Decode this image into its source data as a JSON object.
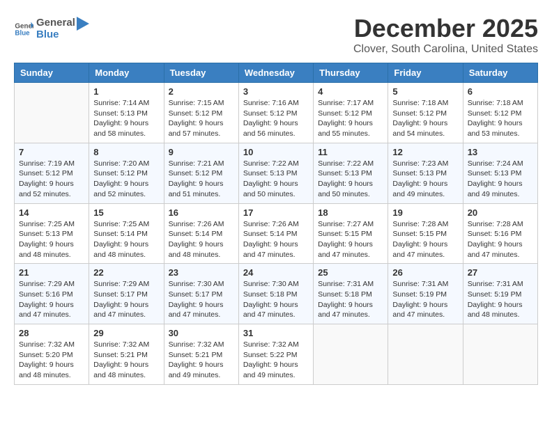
{
  "header": {
    "logo_line1": "General",
    "logo_line2": "Blue",
    "month": "December 2025",
    "location": "Clover, South Carolina, United States"
  },
  "weekdays": [
    "Sunday",
    "Monday",
    "Tuesday",
    "Wednesday",
    "Thursday",
    "Friday",
    "Saturday"
  ],
  "weeks": [
    [
      {
        "day": "",
        "info": ""
      },
      {
        "day": "1",
        "info": "Sunrise: 7:14 AM\nSunset: 5:13 PM\nDaylight: 9 hours\nand 58 minutes."
      },
      {
        "day": "2",
        "info": "Sunrise: 7:15 AM\nSunset: 5:12 PM\nDaylight: 9 hours\nand 57 minutes."
      },
      {
        "day": "3",
        "info": "Sunrise: 7:16 AM\nSunset: 5:12 PM\nDaylight: 9 hours\nand 56 minutes."
      },
      {
        "day": "4",
        "info": "Sunrise: 7:17 AM\nSunset: 5:12 PM\nDaylight: 9 hours\nand 55 minutes."
      },
      {
        "day": "5",
        "info": "Sunrise: 7:18 AM\nSunset: 5:12 PM\nDaylight: 9 hours\nand 54 minutes."
      },
      {
        "day": "6",
        "info": "Sunrise: 7:18 AM\nSunset: 5:12 PM\nDaylight: 9 hours\nand 53 minutes."
      }
    ],
    [
      {
        "day": "7",
        "info": "Sunrise: 7:19 AM\nSunset: 5:12 PM\nDaylight: 9 hours\nand 52 minutes."
      },
      {
        "day": "8",
        "info": "Sunrise: 7:20 AM\nSunset: 5:12 PM\nDaylight: 9 hours\nand 52 minutes."
      },
      {
        "day": "9",
        "info": "Sunrise: 7:21 AM\nSunset: 5:12 PM\nDaylight: 9 hours\nand 51 minutes."
      },
      {
        "day": "10",
        "info": "Sunrise: 7:22 AM\nSunset: 5:13 PM\nDaylight: 9 hours\nand 50 minutes."
      },
      {
        "day": "11",
        "info": "Sunrise: 7:22 AM\nSunset: 5:13 PM\nDaylight: 9 hours\nand 50 minutes."
      },
      {
        "day": "12",
        "info": "Sunrise: 7:23 AM\nSunset: 5:13 PM\nDaylight: 9 hours\nand 49 minutes."
      },
      {
        "day": "13",
        "info": "Sunrise: 7:24 AM\nSunset: 5:13 PM\nDaylight: 9 hours\nand 49 minutes."
      }
    ],
    [
      {
        "day": "14",
        "info": "Sunrise: 7:25 AM\nSunset: 5:13 PM\nDaylight: 9 hours\nand 48 minutes."
      },
      {
        "day": "15",
        "info": "Sunrise: 7:25 AM\nSunset: 5:14 PM\nDaylight: 9 hours\nand 48 minutes."
      },
      {
        "day": "16",
        "info": "Sunrise: 7:26 AM\nSunset: 5:14 PM\nDaylight: 9 hours\nand 48 minutes."
      },
      {
        "day": "17",
        "info": "Sunrise: 7:26 AM\nSunset: 5:14 PM\nDaylight: 9 hours\nand 47 minutes."
      },
      {
        "day": "18",
        "info": "Sunrise: 7:27 AM\nSunset: 5:15 PM\nDaylight: 9 hours\nand 47 minutes."
      },
      {
        "day": "19",
        "info": "Sunrise: 7:28 AM\nSunset: 5:15 PM\nDaylight: 9 hours\nand 47 minutes."
      },
      {
        "day": "20",
        "info": "Sunrise: 7:28 AM\nSunset: 5:16 PM\nDaylight: 9 hours\nand 47 minutes."
      }
    ],
    [
      {
        "day": "21",
        "info": "Sunrise: 7:29 AM\nSunset: 5:16 PM\nDaylight: 9 hours\nand 47 minutes."
      },
      {
        "day": "22",
        "info": "Sunrise: 7:29 AM\nSunset: 5:17 PM\nDaylight: 9 hours\nand 47 minutes."
      },
      {
        "day": "23",
        "info": "Sunrise: 7:30 AM\nSunset: 5:17 PM\nDaylight: 9 hours\nand 47 minutes."
      },
      {
        "day": "24",
        "info": "Sunrise: 7:30 AM\nSunset: 5:18 PM\nDaylight: 9 hours\nand 47 minutes."
      },
      {
        "day": "25",
        "info": "Sunrise: 7:31 AM\nSunset: 5:18 PM\nDaylight: 9 hours\nand 47 minutes."
      },
      {
        "day": "26",
        "info": "Sunrise: 7:31 AM\nSunset: 5:19 PM\nDaylight: 9 hours\nand 47 minutes."
      },
      {
        "day": "27",
        "info": "Sunrise: 7:31 AM\nSunset: 5:19 PM\nDaylight: 9 hours\nand 48 minutes."
      }
    ],
    [
      {
        "day": "28",
        "info": "Sunrise: 7:32 AM\nSunset: 5:20 PM\nDaylight: 9 hours\nand 48 minutes."
      },
      {
        "day": "29",
        "info": "Sunrise: 7:32 AM\nSunset: 5:21 PM\nDaylight: 9 hours\nand 48 minutes."
      },
      {
        "day": "30",
        "info": "Sunrise: 7:32 AM\nSunset: 5:21 PM\nDaylight: 9 hours\nand 49 minutes."
      },
      {
        "day": "31",
        "info": "Sunrise: 7:32 AM\nSunset: 5:22 PM\nDaylight: 9 hours\nand 49 minutes."
      },
      {
        "day": "",
        "info": ""
      },
      {
        "day": "",
        "info": ""
      },
      {
        "day": "",
        "info": ""
      }
    ]
  ]
}
